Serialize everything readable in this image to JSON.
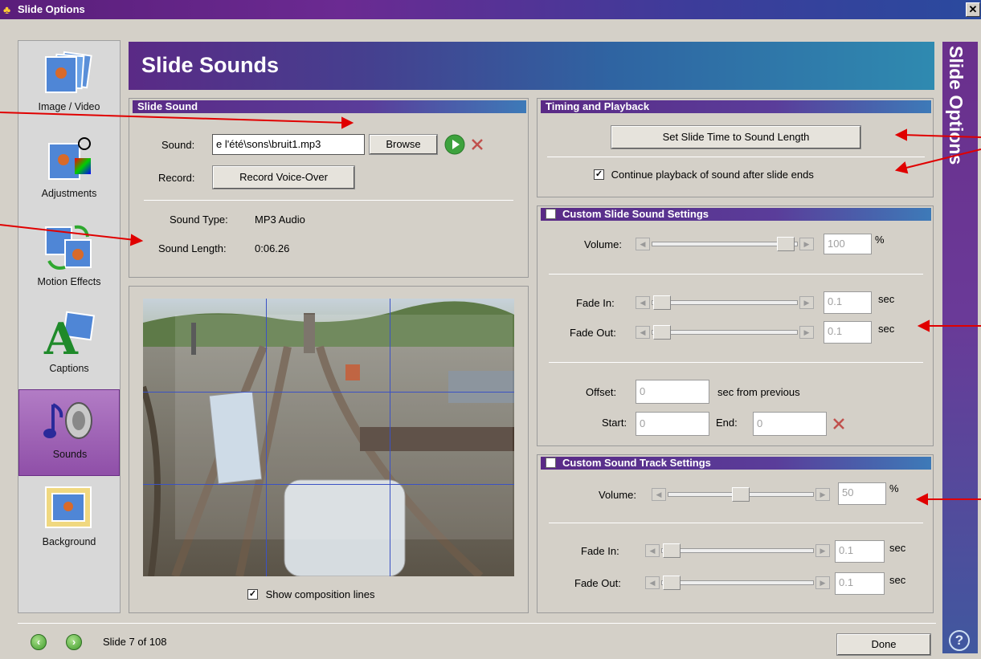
{
  "window": {
    "title": "Slide Options",
    "close_glyph": "✕"
  },
  "sidebar": {
    "items": [
      {
        "label": "Image / Video",
        "icon": "image-video-icon"
      },
      {
        "label": "Adjustments",
        "icon": "adjustments-icon"
      },
      {
        "label": "Motion Effects",
        "icon": "motion-effects-icon"
      },
      {
        "label": "Captions",
        "icon": "captions-icon"
      },
      {
        "label": "Sounds",
        "icon": "sounds-icon",
        "active": true
      },
      {
        "label": "Background",
        "icon": "background-icon"
      }
    ]
  },
  "header": {
    "title": "Slide Sounds",
    "side_title": "Slide Options"
  },
  "slide_sound": {
    "title": "Slide Sound",
    "sound_label": "Sound:",
    "sound_value": "e l'été\\sons\\bruit1.mp3",
    "browse_label": "Browse",
    "record_label": "Record:",
    "record_button": "Record Voice-Over",
    "sound_type_label": "Sound Type:",
    "sound_type_value": "MP3 Audio",
    "sound_length_label": "Sound Length:",
    "sound_length_value": "0:06.26"
  },
  "preview": {
    "show_composition_label": "Show composition lines",
    "show_composition_checked": true
  },
  "timing": {
    "title": "Timing and Playback",
    "set_time_button": "Set Slide Time to Sound Length",
    "continue_label": "Continue playback of sound after slide ends",
    "continue_checked": true
  },
  "custom_slide_sound": {
    "title": "Custom Slide Sound Settings",
    "volume_label": "Volume:",
    "volume_value": "100",
    "volume_unit": "%",
    "volume_level": 1.0,
    "fade_in_label": "Fade In:",
    "fade_in_value": "0.1",
    "fade_out_label": "Fade Out:",
    "fade_out_value": "0.1",
    "sec_unit": "sec",
    "offset_label": "Offset:",
    "offset_value": "0",
    "offset_suffix": "sec from previous",
    "start_label": "Start:",
    "start_value": "0",
    "end_label": "End:",
    "end_value": "0"
  },
  "custom_track": {
    "title": "Custom Sound Track Settings",
    "volume_label": "Volume:",
    "volume_value": "50",
    "volume_unit": "%",
    "volume_level": 0.5,
    "fade_in_label": "Fade In:",
    "fade_in_value": "0.1",
    "fade_out_label": "Fade Out:",
    "fade_out_value": "0.1",
    "sec_unit": "sec"
  },
  "footer": {
    "slide_counter": "Slide 7 of 108",
    "done_label": "Done",
    "help_glyph": "?"
  },
  "colors": {
    "accent_purple": "#5a2a86",
    "accent_blue": "#2f8ab0",
    "annotation_red": "#e00000"
  }
}
